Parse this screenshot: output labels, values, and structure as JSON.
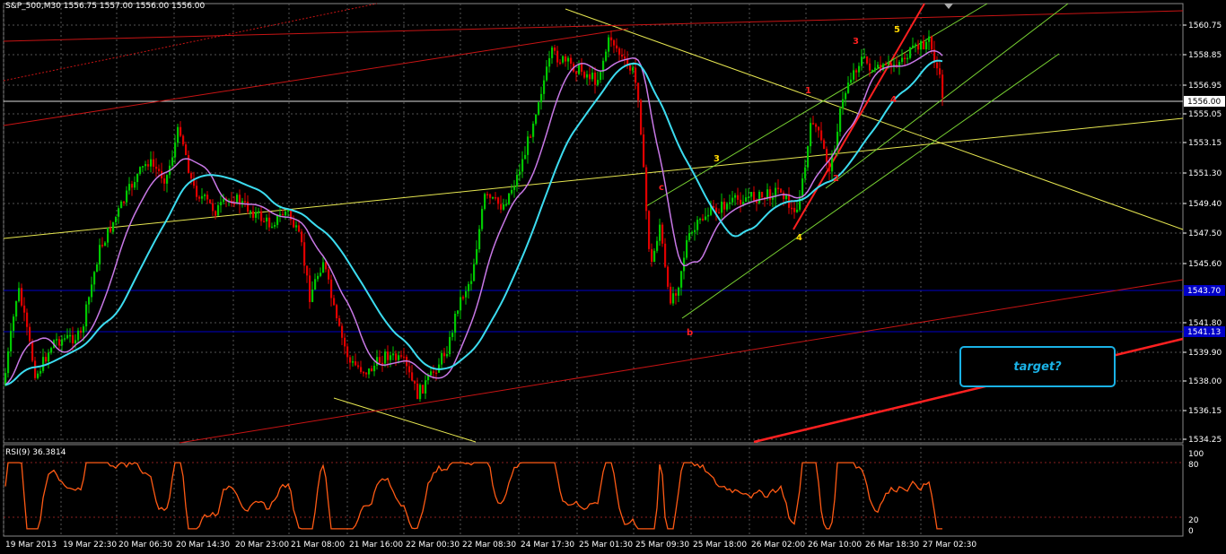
{
  "header": {
    "symbol_timeframe": "S&P_500,M30",
    "ohlc": "1556.75 1557.00 1556.00 1556.00"
  },
  "rsi": {
    "label": "RSI(9) 36.3814",
    "levels": [
      "100",
      "80",
      "20",
      "0"
    ]
  },
  "price_axis": {
    "ticks": [
      "1560.75",
      "1558.85",
      "1556.95",
      "1555.05",
      "1553.15",
      "1551.30",
      "1549.40",
      "1547.50",
      "1545.60",
      "1541.80",
      "1539.90",
      "1538.00",
      "1536.15",
      "1534.25"
    ],
    "current_price": "1556.00",
    "tag_upper": "1543.70",
    "tag_lower": "1541.13"
  },
  "time_axis": {
    "labels": [
      "19 Mar 2013",
      "19 Mar 22:30",
      "20 Mar 06:30",
      "20 Mar 14:30",
      "20 Mar 23:00",
      "21 Mar 08:00",
      "21 Mar 16:00",
      "22 Mar 00:30",
      "22 Mar 08:30",
      "24 Mar 17:30",
      "25 Mar 01:30",
      "25 Mar 09:30",
      "25 Mar 18:00",
      "26 Mar 02:00",
      "26 Mar 10:00",
      "26 Mar 18:30",
      "27 Mar 02:30"
    ]
  },
  "wave_labels": {
    "yellow": [
      "3",
      "4",
      "5"
    ],
    "red": [
      "c",
      "b",
      "1",
      "2",
      "3",
      "4"
    ]
  },
  "target_label": "target?",
  "colors": {
    "bull": "#00c800",
    "bear": "#e00000",
    "ma_fast": "#c878e6",
    "ma_slow": "#3cdcf0",
    "rsi": "#ff5a14",
    "trend_yellow": "#e6e650",
    "trend_red": "#c81414",
    "channel_green": "#78d232",
    "hline_blue": "#0000c8"
  }
}
